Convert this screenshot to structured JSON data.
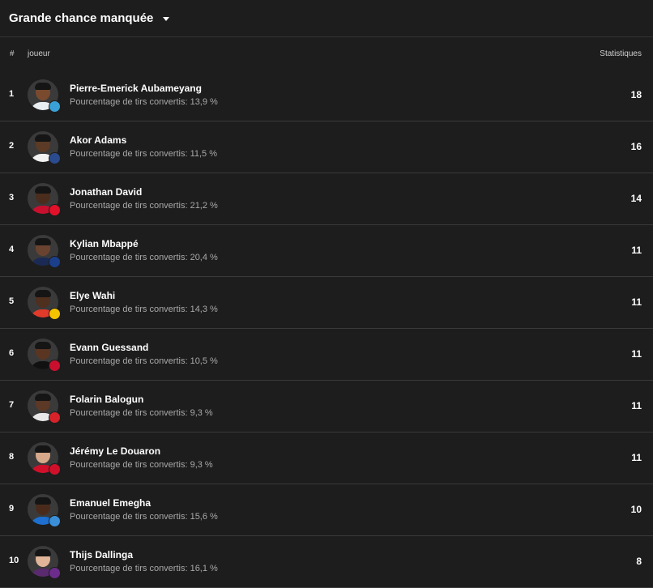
{
  "header": {
    "title": "Grande chance manquée"
  },
  "columns": {
    "rank": "#",
    "player": "joueur",
    "stats": "Statistiques"
  },
  "colors": {
    "background": "#1d1d1d",
    "divider": "#3a3a3a",
    "text": "#ffffff",
    "subtext": "#a9a9a9"
  },
  "players": [
    {
      "rank": "1",
      "name": "Pierre-Emerick Aubameyang",
      "conversion": "Pourcentage de tirs convertis: 13,9 %",
      "stat": "18",
      "skin": "#7a4a2e",
      "shirt": "#e9eef2",
      "club": "#3aa1d8",
      "club_icon": "marseille-badge-icon"
    },
    {
      "rank": "2",
      "name": "Akor Adams",
      "conversion": "Pourcentage de tirs convertis: 11,5 %",
      "stat": "16",
      "skin": "#5b3a26",
      "shirt": "#f2f2f2",
      "club": "#2b4b8f",
      "club_icon": "montpellier-badge-icon"
    },
    {
      "rank": "3",
      "name": "Jonathan David",
      "conversion": "Pourcentage de tirs convertis: 21,2 %",
      "stat": "14",
      "skin": "#4a2d1c",
      "shirt": "#c8102e",
      "club": "#e2112a",
      "club_icon": "lille-badge-icon"
    },
    {
      "rank": "4",
      "name": "Kylian Mbappé",
      "conversion": "Pourcentage de tirs convertis: 20,4 %",
      "stat": "11",
      "skin": "#6a4330",
      "shirt": "#1b2a55",
      "club": "#1b3f8b",
      "club_icon": "psg-badge-icon"
    },
    {
      "rank": "5",
      "name": "Elye Wahi",
      "conversion": "Pourcentage de tirs convertis: 14,3 %",
      "stat": "11",
      "skin": "#4f2f1e",
      "shirt": "#e03a2a",
      "club": "#f5c400",
      "club_icon": "lens-badge-icon"
    },
    {
      "rank": "6",
      "name": "Evann Guessand",
      "conversion": "Pourcentage de tirs convertis: 10,5 %",
      "stat": "11",
      "skin": "#5a3522",
      "shirt": "#111111",
      "club": "#c8102e",
      "club_icon": "nice-badge-icon"
    },
    {
      "rank": "7",
      "name": "Folarin Balogun",
      "conversion": "Pourcentage de tirs convertis: 9,3 %",
      "stat": "11",
      "skin": "#5c3826",
      "shirt": "#e8e8e8",
      "club": "#d8222a",
      "club_icon": "monaco-badge-icon"
    },
    {
      "rank": "8",
      "name": "Jérémy Le Douaron",
      "conversion": "Pourcentage de tirs convertis: 9,3 %",
      "stat": "11",
      "skin": "#d6a98a",
      "shirt": "#d0102a",
      "club": "#d0102a",
      "club_icon": "brest-badge-icon"
    },
    {
      "rank": "9",
      "name": "Emanuel Emegha",
      "conversion": "Pourcentage de tirs convertis: 15,6 %",
      "stat": "10",
      "skin": "#4a2b1b",
      "shirt": "#1d6fd0",
      "club": "#3a8fd8",
      "club_icon": "strasbourg-badge-icon"
    },
    {
      "rank": "10",
      "name": "Thijs Dallinga",
      "conversion": "Pourcentage de tirs convertis: 16,1 %",
      "stat": "8",
      "skin": "#e0b598",
      "shirt": "#5a2a6e",
      "club": "#6b2c8c",
      "club_icon": "toulouse-badge-icon"
    }
  ]
}
